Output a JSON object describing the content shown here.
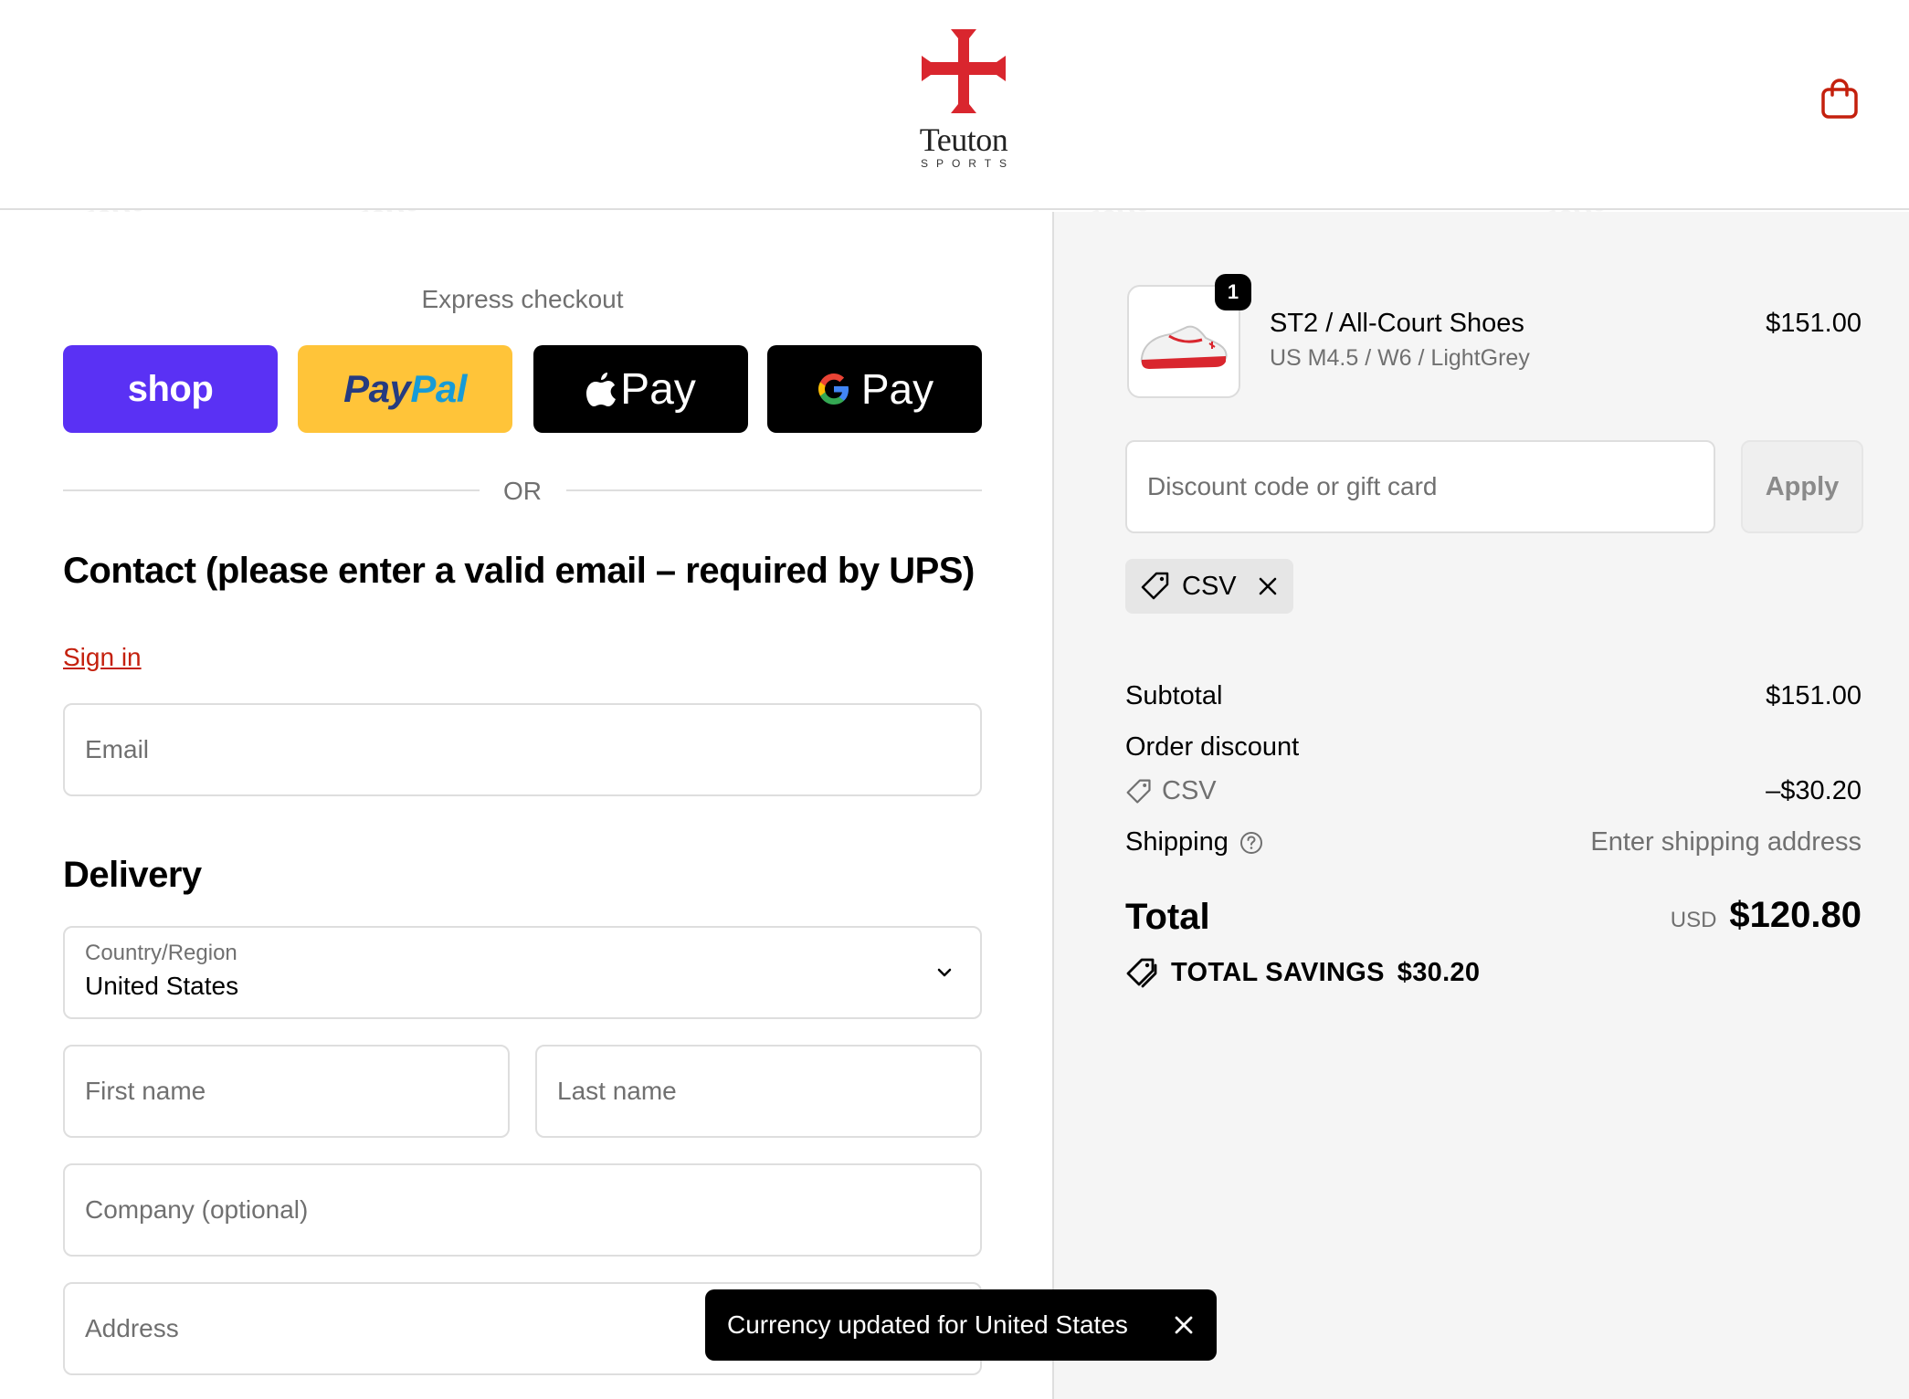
{
  "brand": {
    "name": "Teuton",
    "tagline": "SPORTS",
    "cross_color": "#d9262e"
  },
  "header": {
    "cart_icon": "shopping-bag-icon",
    "accent_color": "#c4200d"
  },
  "express": {
    "title": "Express checkout",
    "buttons": {
      "shop": "shop",
      "paypal_a": "Pay",
      "paypal_b": "Pal",
      "apple": "Pay",
      "google": "Pay"
    },
    "divider": "OR"
  },
  "contact": {
    "heading": "Contact (please enter a valid email – required by UPS)",
    "sign_in": "Sign in",
    "email_placeholder": "Email"
  },
  "delivery": {
    "heading": "Delivery",
    "country_label": "Country/Region",
    "country_value": "United States",
    "first_name_placeholder": "First name",
    "last_name_placeholder": "Last name",
    "company_placeholder": "Company (optional)",
    "address_placeholder": "Address"
  },
  "order": {
    "quantity": "1",
    "item_name": "ST2 / All-Court Shoes",
    "item_variant": "US M4.5 / W6 / LightGrey",
    "item_price": "$151.00",
    "discount_placeholder": "Discount code or gift card",
    "apply_label": "Apply",
    "applied_code": "CSV"
  },
  "summary": {
    "subtotal_label": "Subtotal",
    "subtotal_value": "$151.00",
    "order_discount_label": "Order discount",
    "discount_code": "CSV",
    "discount_value": "–$30.20",
    "shipping_label": "Shipping",
    "shipping_value": "Enter shipping address",
    "total_label": "Total",
    "total_currency": "USD",
    "total_value": "$120.80",
    "savings_label": "TOTAL SAVINGS",
    "savings_value": "$30.20"
  },
  "toast": {
    "message": "Currency updated for United States"
  },
  "watermark": {
    "text": "Tenereteam"
  }
}
